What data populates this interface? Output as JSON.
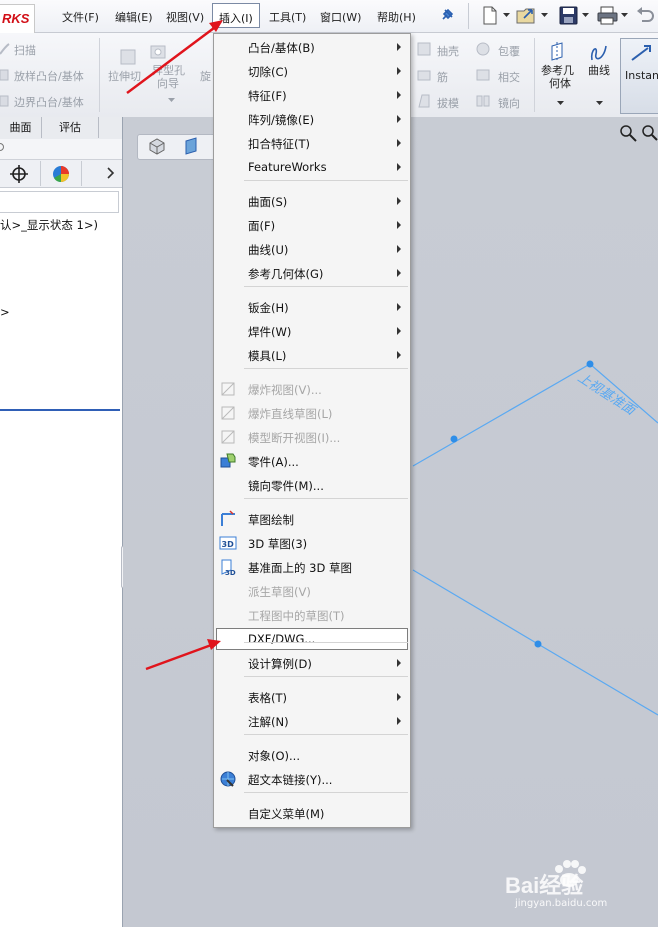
{
  "logo_text": "RKS",
  "menubar": {
    "file": "文件(F)",
    "edit": "编辑(E)",
    "view": "视图(V)",
    "insert": "插入(I)",
    "tools": "工具(T)",
    "window": "窗口(W)",
    "help": "帮助(H)"
  },
  "toolbar": {
    "sweep": "扫描",
    "loft_boss": "放样凸台/基体",
    "boundary_boss": "边界凸台/基体",
    "extrude_cut": "拉伸切",
    "hole_wizard_1": "异型孔",
    "hole_wizard_2": "向导",
    "revolve_cut": "旋",
    "shell": "抽壳",
    "wrap": "包覆",
    "rib": "筋",
    "intersect": "相交",
    "draft": "拔模",
    "mirror": "镜向",
    "ref_geometry_1": "参考几",
    "ref_geometry_2": "何体",
    "curves": "曲线",
    "instant3d": "Instant"
  },
  "left_panel": {
    "tab_surfaces": "曲面",
    "tab_evaluate": "评估",
    "tree_line_1": "认>_显示状态 1>)",
    "tree_line_2": ">"
  },
  "graphics": {
    "plane_label": "上视基准面"
  },
  "dropdown": {
    "items": [
      {
        "label": "凸台/基体(B)",
        "submenu": true,
        "disabled": false
      },
      {
        "label": "切除(C)",
        "submenu": true,
        "disabled": false
      },
      {
        "label": "特征(F)",
        "submenu": true,
        "disabled": false
      },
      {
        "label": "阵列/镜像(E)",
        "submenu": true,
        "disabled": false
      },
      {
        "label": "扣合特征(T)",
        "submenu": true,
        "disabled": false
      },
      {
        "label": "FeatureWorks",
        "submenu": true,
        "disabled": false
      },
      {
        "label": "曲面(S)",
        "submenu": true,
        "disabled": false
      },
      {
        "label": "面(F)",
        "submenu": true,
        "disabled": false
      },
      {
        "label": "曲线(U)",
        "submenu": true,
        "disabled": false
      },
      {
        "label": "参考几何体(G)",
        "submenu": true,
        "disabled": false
      },
      {
        "label": "钣金(H)",
        "submenu": true,
        "disabled": false
      },
      {
        "label": "焊件(W)",
        "submenu": true,
        "disabled": false
      },
      {
        "label": "模具(L)",
        "submenu": true,
        "disabled": false
      },
      {
        "label": "爆炸视图(V)...",
        "submenu": false,
        "disabled": true
      },
      {
        "label": "爆炸直线草图(L)",
        "submenu": false,
        "disabled": true
      },
      {
        "label": "模型断开视图(I)...",
        "submenu": false,
        "disabled": true
      },
      {
        "label": "零件(A)...",
        "submenu": false,
        "disabled": false
      },
      {
        "label": "镜向零件(M)...",
        "submenu": false,
        "disabled": false
      },
      {
        "label": "草图绘制",
        "submenu": false,
        "disabled": false
      },
      {
        "label": "3D 草图(3)",
        "submenu": false,
        "disabled": false
      },
      {
        "label": "基准面上的 3D 草图",
        "submenu": false,
        "disabled": false
      },
      {
        "label": "派生草图(V)",
        "submenu": false,
        "disabled": true
      },
      {
        "label": "工程图中的草图(T)",
        "submenu": false,
        "disabled": true
      },
      {
        "label": "DXF/DWG...",
        "submenu": false,
        "disabled": false,
        "highlighted": true
      },
      {
        "label": "设计算例(D)",
        "submenu": true,
        "disabled": false
      },
      {
        "label": "表格(T)",
        "submenu": true,
        "disabled": false
      },
      {
        "label": "注解(N)",
        "submenu": true,
        "disabled": false
      },
      {
        "label": "对象(O)...",
        "submenu": false,
        "disabled": false
      },
      {
        "label": "超文本链接(Y)...",
        "submenu": false,
        "disabled": false
      },
      {
        "label": "自定义菜单(M)",
        "submenu": false,
        "disabled": false
      }
    ]
  },
  "colors": {
    "accent_red": "#e0141c",
    "plane_blue": "#5aa9f2",
    "highlight_border": "#7d7d7d"
  },
  "watermark": {
    "brand": "Bai经验",
    "url": "jingyan.baidu.com"
  }
}
